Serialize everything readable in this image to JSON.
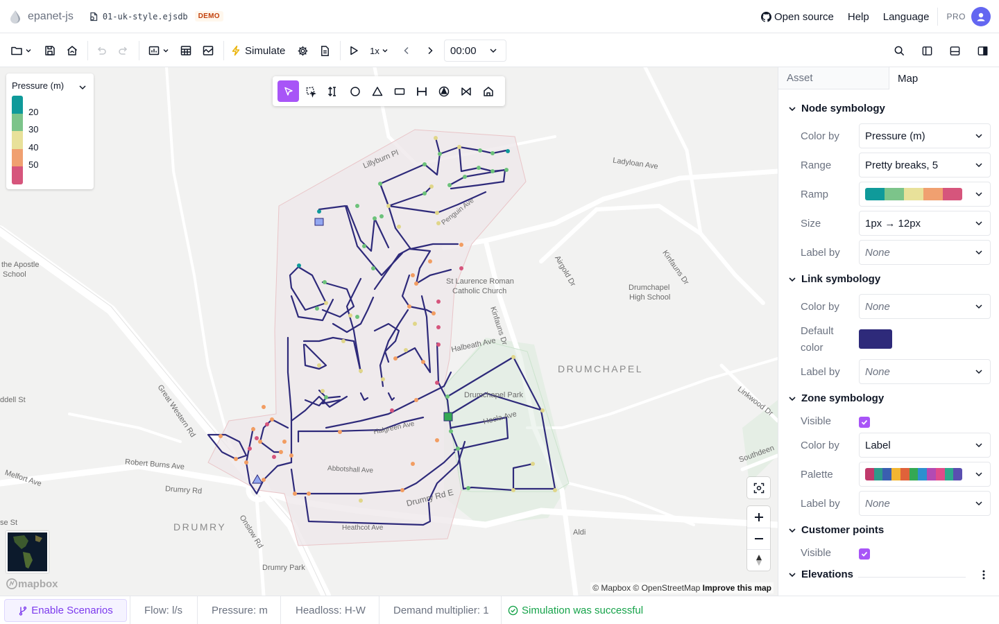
{
  "header": {
    "brand": "epanet-js",
    "file_name": "01-uk-style.ejsdb",
    "demo_badge": "DEMO",
    "links": [
      "Open source",
      "Help",
      "Language"
    ],
    "plan": "PRO"
  },
  "toolbar": {
    "simulate_label": "Simulate",
    "speed_label": "1x",
    "time_value": "00:00"
  },
  "legend": {
    "title": "Pressure (m)",
    "ticks": [
      "20",
      "30",
      "40",
      "50"
    ],
    "colors": [
      "#0f9a9a",
      "#7cc48a",
      "#e8e19a",
      "#f0a070",
      "#d6557c"
    ]
  },
  "map_labels": {
    "lillyburn": "Lillyburn Pl",
    "ladyloan": "Ladyloan Ave",
    "apostle_1": "the Apostle",
    "apostle_2": "School",
    "st_laurence_1": "St Laurence Roman",
    "st_laurence_2": "Catholic Church",
    "airgold": "Airgold Dr",
    "kinfauns_top": "Kinfauns Dr",
    "drumchapel_high_1": "Drumchapel",
    "drumchapel_high_2": "High School",
    "kinfauns_mid": "Kinfauns Dr",
    "halbeath": "Halbeath Ave",
    "drumchapel": "DRUMCHAPEL",
    "drumchapel_park": "Drumchapel Park",
    "hecla": "Hecla Ave",
    "linkwood": "Linkwood Dr",
    "dell": "ddell St",
    "great_western": "Great Western Rd",
    "robert_burns": "Robert Burns Ave",
    "melfort": "Melfort Ave",
    "drumry_rd": "Drumry Rd",
    "southdeen": "Southdeen",
    "se_st": "se St",
    "drumry": "DRUMRY",
    "onslow": "Onslow Rd",
    "aldi": "Aldi",
    "drumry_park": "Drumry Park",
    "abbotshall": "Abbotshall Ave",
    "heathcot": "Heathcot Ave",
    "drumry_rd_e": "Drumry Rd E",
    "halgreen": "Halgreen Ave",
    "peng": "Penguin Ave"
  },
  "attribution": {
    "text": "© Mapbox © OpenStreetMap",
    "improve": "Improve this map",
    "logo": "mapbox"
  },
  "panel": {
    "tabs": [
      "Asset",
      "Map"
    ],
    "node_symbology": {
      "title": "Node symbology",
      "color_by_label": "Color by",
      "color_by_value": "Pressure (m)",
      "range_label": "Range",
      "range_value": "Pretty breaks, 5",
      "ramp_label": "Ramp",
      "ramp_colors": [
        "#0f9a9a",
        "#7cc48a",
        "#e8e19a",
        "#f0a070",
        "#d6557c"
      ],
      "size_label": "Size",
      "size_value": "1px → 12px",
      "label_by_label": "Label by",
      "label_by_value": "None"
    },
    "link_symbology": {
      "title": "Link symbology",
      "color_by_label": "Color by",
      "color_by_value": "None",
      "default_color_label_1": "Default",
      "default_color_label_2": "color",
      "default_color": "#2e2a7a",
      "label_by_label": "Label by",
      "label_by_value": "None"
    },
    "zone_symbology": {
      "title": "Zone symbology",
      "visible_label": "Visible",
      "color_by_label": "Color by",
      "color_by_value": "Label",
      "palette_label": "Palette",
      "palette_colors": [
        "#c0396b",
        "#2e9a8a",
        "#3a5fb0",
        "#f2b531",
        "#e0623a",
        "#34a853",
        "#2d8fcf",
        "#b34ab3",
        "#e04b8a",
        "#2fa88c",
        "#5a4fb0"
      ],
      "label_by_label": "Label by",
      "label_by_value": "None"
    },
    "customer_points": {
      "title": "Customer points",
      "visible_label": "Visible"
    },
    "elevations": {
      "title": "Elevations"
    }
  },
  "footer": {
    "enable_scenarios": "Enable Scenarios",
    "flow": "Flow: l/s",
    "pressure": "Pressure: m",
    "headloss": "Headloss: H-W",
    "demand": "Demand multiplier: 1",
    "status": "Simulation was successful"
  },
  "colors": {
    "accent": "#a855f7",
    "pipe": "#2e2a7a",
    "success": "#16a34a"
  }
}
